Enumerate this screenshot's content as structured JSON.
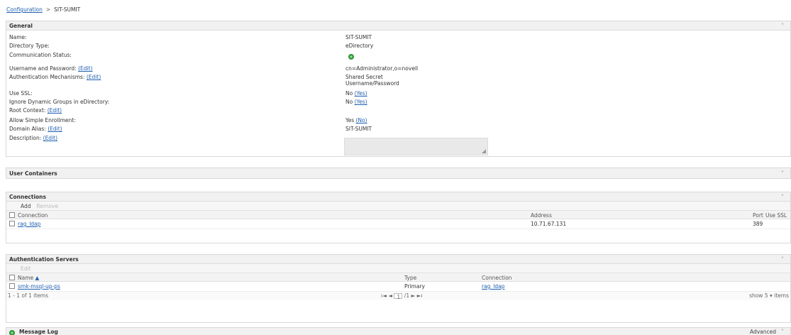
{
  "breadcrumb": {
    "root": "Configuration",
    "sep": ">",
    "current": "SIT-SUMIT"
  },
  "general": {
    "title": "General",
    "rows": [
      {
        "label": "Name:",
        "value": "SIT-SUMIT"
      },
      {
        "label": "Directory Type:",
        "value": "eDirectory"
      },
      {
        "label": "Communication Status:"
      },
      {
        "label": "Username and Password:",
        "edit": "(Edit)",
        "value": "cn=Administrator,o=novell"
      },
      {
        "label": "Authentication Mechanisms:",
        "edit": "(Edit)",
        "value": "Shared Secret",
        "value2": "Username/Password"
      },
      {
        "label": "Use SSL:",
        "value": "No",
        "toggle": "(Yes)"
      },
      {
        "label": "Ignore Dynamic Groups in eDirectory:",
        "value": "No",
        "toggle": "(Yes)"
      },
      {
        "label": "Root Context:",
        "edit": "(Edit)"
      },
      {
        "label": "Allow Simple Enrollment:",
        "value": "Yes",
        "toggle": "(No)"
      },
      {
        "label": "Domain Alias:",
        "edit": "(Edit)",
        "value": "SIT-SUMIT"
      },
      {
        "label": "Description:",
        "edit": "(Edit)"
      }
    ]
  },
  "containers": {
    "title": "User Containers"
  },
  "connections": {
    "title": "Connections",
    "add": "Add",
    "remove": "Remove",
    "columns": {
      "connection": "Connection",
      "address": "Address",
      "port": "Port",
      "ssl": "Use SSL"
    },
    "rows": [
      {
        "connection": "rag_ldap",
        "address": "10.71.67.131",
        "port": "389",
        "ssl": ""
      }
    ]
  },
  "authservers": {
    "title": "Authentication Servers",
    "edit": "Edit",
    "columns": {
      "name": "Name",
      "sort": "▲",
      "type": "Type",
      "connection": "Connection"
    },
    "rows": [
      {
        "name": "smk-msql-up-ps",
        "type": "Primary",
        "connection": "rag_ldap"
      }
    ],
    "pager": {
      "summary": "1 - 1 of 1 items",
      "nav_left": "ı◄ ◄",
      "page": "1",
      "of": "/1",
      "nav_right": "► ►ı",
      "show": "show 5 ▾ items"
    }
  },
  "msglog": {
    "title": "Message Log",
    "advanced": "Advanced"
  },
  "icons": {
    "up": "˄",
    "down": "˅"
  }
}
